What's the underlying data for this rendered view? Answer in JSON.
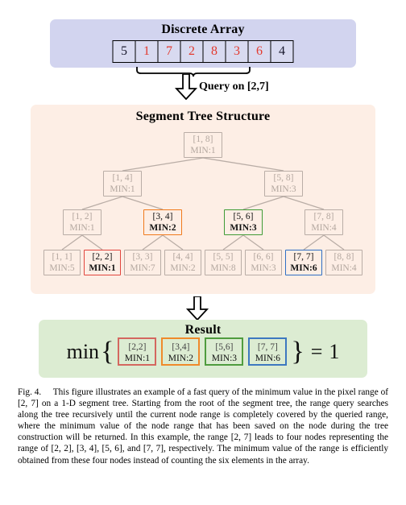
{
  "array_section": {
    "title": "Discrete Array",
    "values": [
      "5",
      "1",
      "7",
      "2",
      "8",
      "3",
      "6",
      "4"
    ],
    "highlighted_indices": [
      1,
      2,
      3,
      4,
      5,
      6
    ],
    "query_label": "Query on [2,7]",
    "panel_color": "#d2d4ef",
    "highlight_color": "#e33a2e"
  },
  "tree_section": {
    "title": "Segment Tree Structure",
    "panel_color": "#fdeee5",
    "levels": [
      {
        "nodes": [
          {
            "range": "[1, 8]",
            "min": "MIN:1",
            "state": "inactive",
            "color": ""
          }
        ]
      },
      {
        "nodes": [
          {
            "range": "[1, 4]",
            "min": "MIN:1",
            "state": "inactive",
            "color": ""
          },
          {
            "range": "[5, 8]",
            "min": "MIN:3",
            "state": "inactive",
            "color": ""
          }
        ]
      },
      {
        "nodes": [
          {
            "range": "[1, 2]",
            "min": "MIN:1",
            "state": "inactive",
            "color": ""
          },
          {
            "range": "[3, 4]",
            "min": "MIN:2",
            "state": "active",
            "color": "#f07a1c"
          },
          {
            "range": "[5, 6]",
            "min": "MIN:3",
            "state": "active",
            "color": "#3f9b35"
          },
          {
            "range": "[7, 8]",
            "min": "MIN:4",
            "state": "inactive",
            "color": ""
          }
        ]
      },
      {
        "nodes": [
          {
            "range": "[1, 1]",
            "min": "MIN:5",
            "state": "inactive",
            "color": ""
          },
          {
            "range": "[2, 2]",
            "min": "MIN:1",
            "state": "active",
            "color": "#e2453d"
          },
          {
            "range": "[3, 3]",
            "min": "MIN:7",
            "state": "inactive",
            "color": ""
          },
          {
            "range": "[4, 4]",
            "min": "MIN:2",
            "state": "inactive",
            "color": ""
          },
          {
            "range": "[5, 5]",
            "min": "MIN:8",
            "state": "inactive",
            "color": ""
          },
          {
            "range": "[6, 6]",
            "min": "MIN:3",
            "state": "inactive",
            "color": ""
          },
          {
            "range": "[7, 7]",
            "min": "MIN:6",
            "state": "active",
            "color": "#2f6fc4"
          },
          {
            "range": "[8, 8]",
            "min": "MIN:4",
            "state": "inactive",
            "color": ""
          }
        ]
      }
    ]
  },
  "result_section": {
    "title": "Result",
    "panel_color": "#dcecd2",
    "min_label": "min",
    "open_brace": "{",
    "close_brace": "}",
    "equals": "=",
    "value": "1",
    "boxes": [
      {
        "range": "[2,2]",
        "min": "MIN:1",
        "color": "#d4675f"
      },
      {
        "range": "[3,4]",
        "min": "MIN:2",
        "color": "#ef8a2b"
      },
      {
        "range": "[5,6]",
        "min": "MIN:3",
        "color": "#4f9c3e"
      },
      {
        "range": "[7, 7]",
        "min": "MIN:6",
        "color": "#3d78c0"
      }
    ]
  },
  "caption": {
    "label": "Fig. 4.",
    "text": "This figure illustrates an example of a fast query of the minimum value in the pixel range of [2, 7] on a 1-D segment tree. Starting from the root of the segment tree, the range query searches along the tree recursively until the current node range is completely covered by the queried range, where the minimum value of the node range that has been saved on the node during the tree construction will be returned. In this example, the range [2, 7] leads to four nodes representing the range of [2, 2], [3, 4], [5, 6], and [7, 7], respectively. The minimum value of the range is efficiently obtained from these four nodes instead of counting the six elements in the array."
  }
}
